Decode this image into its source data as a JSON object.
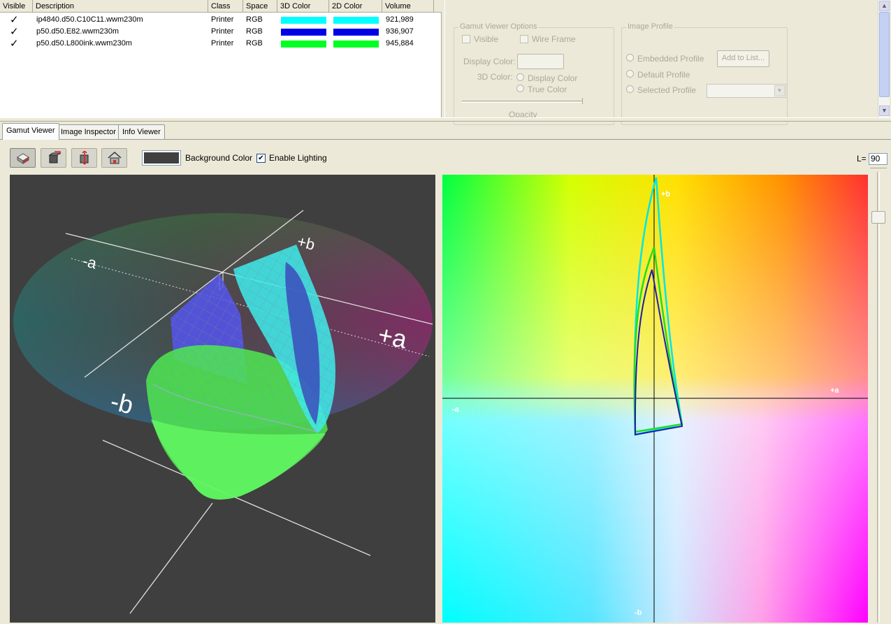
{
  "table": {
    "columns": [
      "Visible",
      "Description",
      "Class",
      "Space",
      "3D Color",
      "2D Color",
      "Volume"
    ],
    "rows": [
      {
        "visible": "✓",
        "description": "ip4840.d50.C10C11.wwm230m",
        "class": "Printer",
        "space": "RGB",
        "color3d": "#00ffff",
        "color2d": "#00ffff",
        "volume": "921,989"
      },
      {
        "visible": "✓",
        "description": "p50.d50.E82.wwm230m",
        "class": "Printer",
        "space": "RGB",
        "color3d": "#0000e6",
        "color2d": "#0000e6",
        "volume": "936,907"
      },
      {
        "visible": "✓",
        "description": "p50.d50.L800ink.wwm230m",
        "class": "Printer",
        "space": "RGB",
        "color3d": "#00ff22",
        "color2d": "#00ff22",
        "volume": "945,884"
      }
    ]
  },
  "options": {
    "gamut_group": "Gamut Viewer Options",
    "visible": "Visible",
    "wire_frame": "Wire Frame",
    "display_color": "Display Color:",
    "color_3d": "3D Color:",
    "display_color_radio": "Display Color",
    "true_color_radio": "True Color",
    "opacity": "Opacity",
    "profile_group": "Image Profile",
    "embedded": "Embedded Profile",
    "default": "Default Profile",
    "selected": "Selected Profile",
    "add_to_list": "Add to List..."
  },
  "tabs": [
    "Gamut Viewer",
    "Image Inspector",
    "Info Viewer"
  ],
  "toolbar": {
    "background_color_label": "Background Color",
    "background_color": "#404040",
    "enable_lighting_label": "Enable Lighting",
    "enable_lighting_checked": "✔",
    "l_label": "L=",
    "l_value": "90",
    "tools": [
      "view-3d-icon",
      "rotate-icon",
      "zoom-icon",
      "home-icon"
    ]
  },
  "view3d": {
    "axis_labels": {
      "a_neg": "-a",
      "a_pos": "+a",
      "b_neg": "-b",
      "b_pos": "+b"
    }
  },
  "view2d": {
    "axis_labels": {
      "a_neg": "-a",
      "a_pos": "+a",
      "b_neg": "-b",
      "b_pos": "+b"
    },
    "slice_colors": [
      "#00e6e6",
      "#22dd22",
      "#1c1cb0"
    ]
  }
}
